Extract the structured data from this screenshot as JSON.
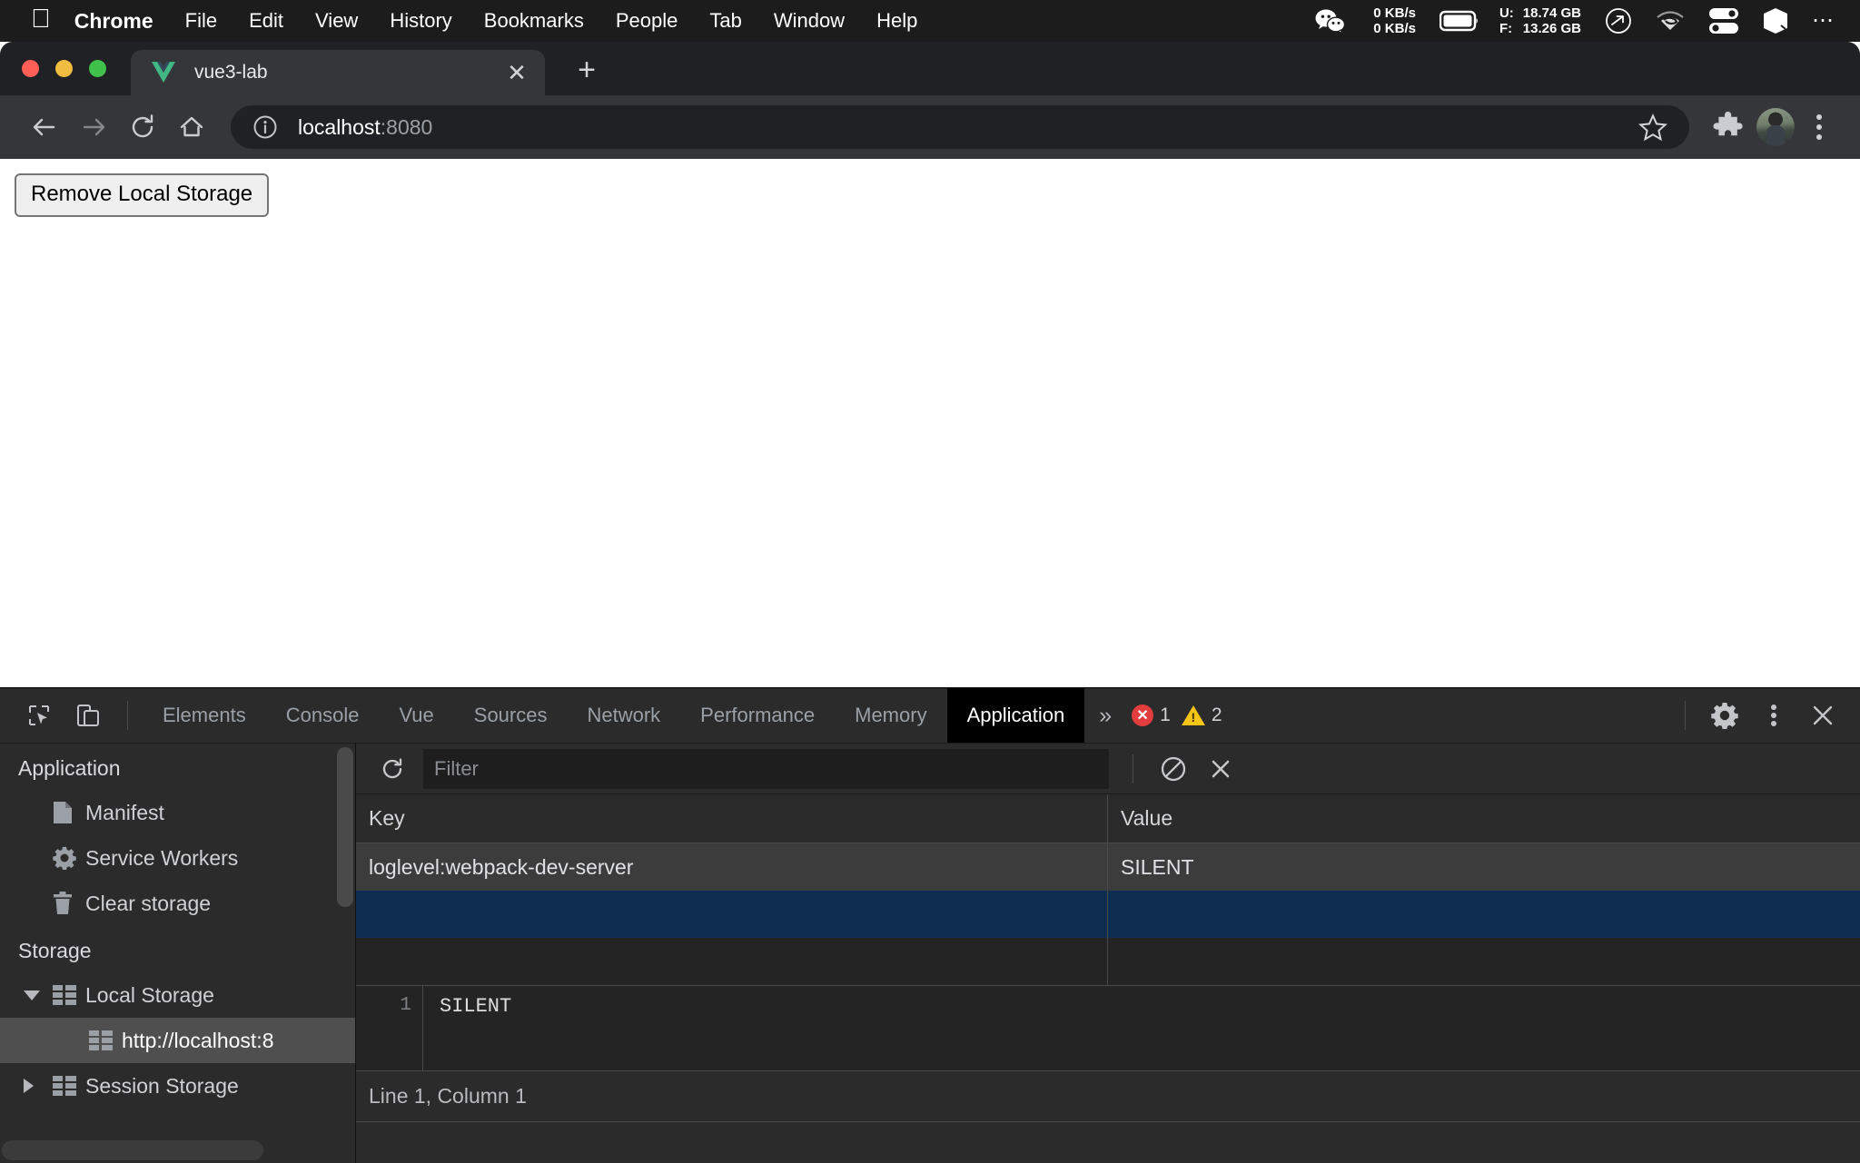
{
  "menubar": {
    "apple_icon": "apple-logo",
    "items": [
      {
        "label": "Chrome",
        "bold": true
      },
      {
        "label": "File",
        "bold": false
      },
      {
        "label": "Edit",
        "bold": false
      },
      {
        "label": "View",
        "bold": false
      },
      {
        "label": "History",
        "bold": false
      },
      {
        "label": "Bookmarks",
        "bold": false
      },
      {
        "label": "People",
        "bold": false
      },
      {
        "label": "Tab",
        "bold": false
      },
      {
        "label": "Window",
        "bold": false
      },
      {
        "label": "Help",
        "bold": false
      }
    ],
    "status": {
      "wechat_icon": "wechat-icon",
      "net_up": "0 KB/s",
      "net_down": "0 KB/s",
      "battery_icon": "battery-icon",
      "mem_used_label": "U:",
      "mem_used_value": "18.74 GB",
      "mem_free_label": "F:",
      "mem_free_value": "13.26 GB",
      "clock_icon": "clock-arrow-icon",
      "wifi_icon": "wifi-icon",
      "toggles_icon": "control-center-icon",
      "cube_icon": "cube-icon",
      "more_icon": "ellipsis-icon"
    }
  },
  "browser": {
    "tab": {
      "title": "vue3-lab",
      "favicon": "vue-logo-icon",
      "close_label": "✕"
    },
    "new_tab_label": "+",
    "nav": {
      "back_icon": "arrow-left-icon",
      "forward_icon": "arrow-right-icon",
      "reload_icon": "reload-icon",
      "home_icon": "home-icon"
    },
    "omnibox": {
      "info_icon": "info-circle-icon",
      "url_host": "localhost",
      "url_port": ":8080",
      "star_icon": "star-icon"
    },
    "extensions_icon": "puzzle-piece-icon",
    "avatar_icon": "profile-avatar",
    "menu_icon": "kebab-menu-icon"
  },
  "page": {
    "remove_storage_button": "Remove Local Storage"
  },
  "devtools": {
    "inspect_icon": "inspect-element-icon",
    "device_icon": "device-toolbar-icon",
    "tabs": [
      {
        "label": "Elements",
        "active": false
      },
      {
        "label": "Console",
        "active": false
      },
      {
        "label": "Vue",
        "active": false
      },
      {
        "label": "Sources",
        "active": false
      },
      {
        "label": "Network",
        "active": false
      },
      {
        "label": "Performance",
        "active": false
      },
      {
        "label": "Memory",
        "active": false
      },
      {
        "label": "Application",
        "active": true
      }
    ],
    "more_tabs_icon": "»",
    "error_count": "1",
    "warning_count": "2",
    "settings_icon": "gear-icon",
    "kebab_icon": "kebab-menu-icon",
    "close_icon": "close-icon",
    "sidebar": {
      "application_group": "Application",
      "application_items": [
        {
          "label": "Manifest",
          "icon": "document-icon"
        },
        {
          "label": "Service Workers",
          "icon": "gear-icon"
        },
        {
          "label": "Clear storage",
          "icon": "trash-icon"
        }
      ],
      "storage_group": "Storage",
      "storage_items": [
        {
          "label": "Local Storage",
          "icon": "table-icon",
          "expanded": true,
          "selected": false
        },
        {
          "label": "http://localhost:8",
          "icon": "table-icon",
          "child": true,
          "selected": true
        },
        {
          "label": "Session Storage",
          "icon": "table-icon",
          "expanded": false,
          "selected": false
        }
      ]
    },
    "toolbar": {
      "refresh_icon": "refresh-icon",
      "filter_placeholder": "Filter",
      "filter_value": "",
      "clear_all_icon": "clear-all-icon",
      "delete_icon": "delete-selected-icon"
    },
    "table": {
      "columns": [
        "Key",
        "Value"
      ],
      "rows": [
        {
          "key": "loglevel:webpack-dev-server",
          "value": "SILENT",
          "selected": false
        },
        {
          "key": "",
          "value": "",
          "selected": true
        }
      ]
    },
    "preview": {
      "line_number": "1",
      "content": "SILENT"
    },
    "status": "Line 1, Column 1"
  },
  "colors": {
    "menubar_bg": "#1c1c1c",
    "chrome_tabstrip": "#202124",
    "chrome_toolbar": "#35363a",
    "devtools_bg": "#242424",
    "devtools_panel": "#2b2b2b",
    "row_selected": "#0f2d51",
    "row_data": "#3c3c3c",
    "error_red": "#e33d3d",
    "warning_yellow": "#f5c518",
    "vue_green": "#41b883"
  }
}
